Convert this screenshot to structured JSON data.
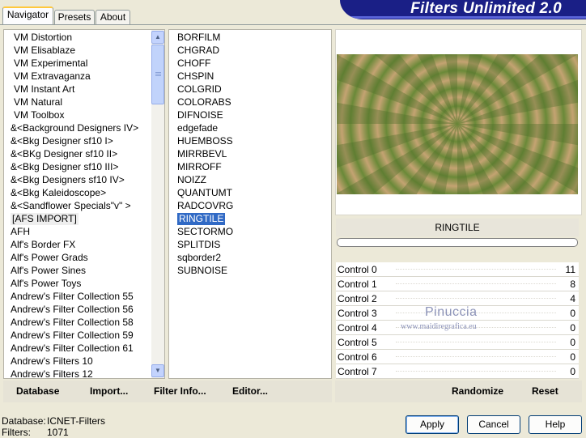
{
  "banner": {
    "title": "Filters Unlimited 2.0"
  },
  "tabs": [
    {
      "label": "Navigator"
    },
    {
      "label": "Presets"
    },
    {
      "label": "About"
    }
  ],
  "categories": [
    "VM Distortion",
    "VM Elisablaze",
    "VM Experimental",
    "VM Extravaganza",
    "VM Instant Art",
    "VM Natural",
    "VM Toolbox",
    "&<Background Designers IV>",
    "&<Bkg Designer sf10 I>",
    "&<BKg Designer sf10 II>",
    "&<Bkg Designer sf10 III>",
    "&<Bkg Designers sf10 IV>",
    "&<Bkg Kaleidoscope>",
    "&<Sandflower Specials\"v\" >",
    "[AFS IMPORT]",
    "AFH",
    "Alf's Border FX",
    "Alf's Power Grads",
    "Alf's Power Sines",
    "Alf's Power Toys",
    "Andrew's Filter Collection 55",
    "Andrew's Filter Collection 56",
    "Andrew's Filter Collection 58",
    "Andrew's Filter Collection 59",
    "Andrew's Filter Collection 61",
    "Andrew's Filters 10",
    "Andrew's Filters 12"
  ],
  "selected_category": "[AFS IMPORT]",
  "filters": [
    "BORFILM",
    "CHGRAD",
    "CHOFF",
    "CHSPIN",
    "COLGRID",
    "COLORABS",
    "DIFNOISE",
    "edgefade",
    "HUEMBOSS",
    "MIRRBEVL",
    "MIRROFF",
    "NOIZZ",
    "QUANTUMT",
    "RADCOVRG",
    "RINGTILE",
    "SECTORMO",
    "SPLITDIS",
    "sqborder2",
    "SUBNOISE"
  ],
  "selected_filter": "RINGTILE",
  "preview": {
    "filter_name": "RINGTILE",
    "progress": 0
  },
  "controls": [
    {
      "label": "Control 0",
      "value": "11"
    },
    {
      "label": "Control 1",
      "value": "8"
    },
    {
      "label": "Control 2",
      "value": "4"
    },
    {
      "label": "Control 3",
      "value": "0"
    },
    {
      "label": "Control 4",
      "value": "0"
    },
    {
      "label": "Control 5",
      "value": "0"
    },
    {
      "label": "Control 6",
      "value": "0"
    },
    {
      "label": "Control 7",
      "value": "0"
    }
  ],
  "watermark": {
    "name": "Pinuccia",
    "url": "www.maidiregrafica.eu"
  },
  "toolbar_left": {
    "database": "Database",
    "import": "Import...",
    "filter_info": "Filter Info...",
    "editor": "Editor..."
  },
  "toolbar_right": {
    "randomize": "Randomize",
    "reset": "Reset"
  },
  "status": {
    "database_label": "Database:",
    "database_value": "ICNET-Filters",
    "filters_label": "Filters:",
    "filters_value": "1071"
  },
  "buttons": {
    "apply": "Apply",
    "cancel": "Cancel",
    "help": "Help"
  },
  "colors": {
    "accent": "#316ac5",
    "banner": "#1a1f86",
    "tab_highlight": "#ffc83c",
    "preview_green": "#6e8a3a",
    "preview_tan": "#c4a372"
  }
}
